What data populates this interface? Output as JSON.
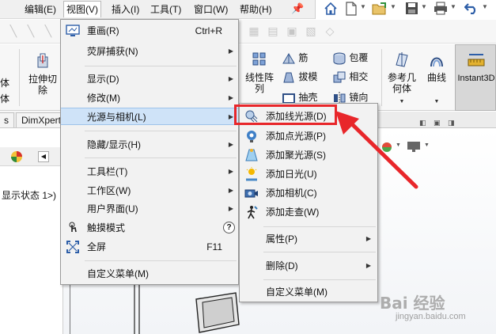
{
  "menubar": {
    "items": [
      "编辑(E)",
      "视图(V)",
      "插入(I)",
      "工具(T)",
      "窗口(W)",
      "帮助(H)"
    ],
    "active": "视图(V)"
  },
  "quickbar": {
    "icons": [
      "home-icon",
      "new-document-icon",
      "open-folder-icon",
      "save-icon",
      "print-icon",
      "undo-icon"
    ]
  },
  "ribbon": {
    "left_fragments": [
      "体",
      "体"
    ],
    "extrude_cut": "拉伸切\n除",
    "linear_pattern": "线性阵\n列",
    "rib": "筋",
    "draft": "拔模",
    "shell": "抽壳",
    "wrap": "包覆",
    "intersect": "相交",
    "mirror": "镜向",
    "reference_geometry": "参考几\n何体",
    "curves": "曲线",
    "instant3d": "Instant3D"
  },
  "tabs": {
    "left_fragment": "s",
    "dimxpert": "DimXpert"
  },
  "left_panel": {
    "state_text": "显示状态 1>)"
  },
  "view_menu": {
    "items": [
      {
        "label": "重画(R)",
        "shortcut": "Ctrl+R",
        "icon": "redraw-icon",
        "submenu": false
      },
      {
        "label": "荧屏捕获(N)",
        "shortcut": "",
        "icon": "",
        "submenu": true
      },
      {
        "label": "显示(D)",
        "shortcut": "",
        "icon": "",
        "submenu": true
      },
      {
        "label": "修改(M)",
        "shortcut": "",
        "icon": "",
        "submenu": true
      },
      {
        "label": "光源与相机(L)",
        "shortcut": "",
        "icon": "",
        "submenu": true
      },
      {
        "label": "隐藏/显示(H)",
        "shortcut": "",
        "icon": "",
        "submenu": true
      },
      {
        "label": "工具栏(T)",
        "shortcut": "",
        "icon": "",
        "submenu": true
      },
      {
        "label": "工作区(W)",
        "shortcut": "",
        "icon": "",
        "submenu": true
      },
      {
        "label": "用户界面(U)",
        "shortcut": "",
        "icon": "",
        "submenu": true
      },
      {
        "label": "触摸模式",
        "shortcut": "",
        "icon": "touch-icon",
        "submenu": false
      },
      {
        "label": "全屏",
        "shortcut": "F11",
        "icon": "fullscreen-icon",
        "submenu": false
      },
      {
        "label": "自定义菜单(M)",
        "shortcut": "",
        "icon": "",
        "submenu": false
      }
    ],
    "help_glyph": "?"
  },
  "submenu": {
    "items": [
      {
        "label": "添加线光源(D)",
        "icon": "directional-light-icon",
        "submenu": false
      },
      {
        "label": "添加点光源(P)",
        "icon": "point-light-icon",
        "submenu": false
      },
      {
        "label": "添加聚光源(S)",
        "icon": "spot-light-icon",
        "submenu": false
      },
      {
        "label": "添加日光(U)",
        "icon": "sunlight-icon",
        "submenu": false
      },
      {
        "label": "添加相机(C)",
        "icon": "camera-icon",
        "submenu": false
      },
      {
        "label": "添加走查(W)",
        "icon": "walkthrough-icon",
        "submenu": false
      },
      {
        "label": "属性(P)",
        "icon": "",
        "submenu": true
      },
      {
        "label": "删除(D)",
        "icon": "",
        "submenu": true
      },
      {
        "label": "自定义菜单(M)",
        "icon": "",
        "submenu": false
      }
    ]
  },
  "annotation": {
    "highlight_color": "#e8262a",
    "target": "添加线光源(D)"
  },
  "watermark": {
    "logo": "Bai 经验",
    "url": "jingyan.baidu.com"
  },
  "colors": {
    "menu_bg": "#f2f2f2",
    "hover_bg": "#cfe3f8",
    "annotation_red": "#e8262a"
  }
}
